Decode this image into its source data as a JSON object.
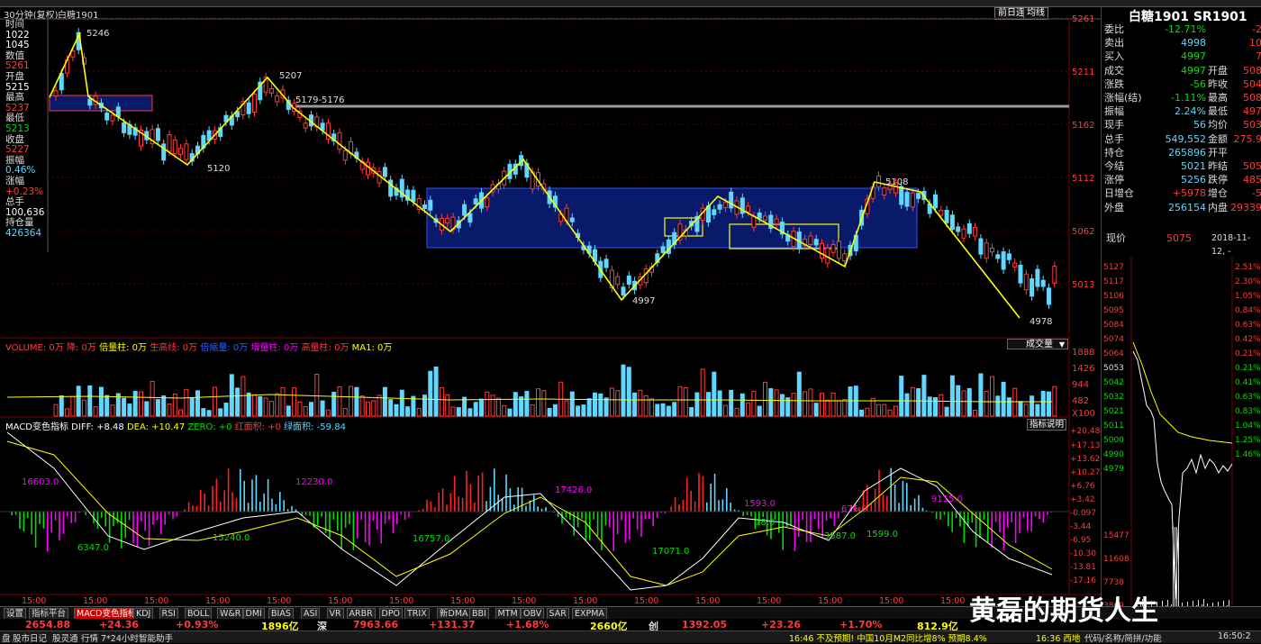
{
  "header": {
    "period_label": "30分钟(复权)",
    "symbol_label": "白糖1901",
    "btn_period": "前日连",
    "btn_avg": "均线"
  },
  "info_panel": [
    {
      "label": "时间",
      "value": "1022",
      "value2": "1045"
    },
    {
      "label": "数值",
      "value": "5261"
    },
    {
      "label": "开盘",
      "value": "5215"
    },
    {
      "label": "最高",
      "value": "5237"
    },
    {
      "label": "最低",
      "value": "5213"
    },
    {
      "label": "收盘",
      "value": "5227"
    },
    {
      "label": "振幅",
      "value": "0.46%"
    },
    {
      "label": "涨幅",
      "value": "+0.23%"
    },
    {
      "label": "总手",
      "value": "100,636"
    },
    {
      "label": "持仓量",
      "value": "426364"
    }
  ],
  "price_axis": [
    "5261",
    "5211",
    "5162",
    "5112",
    "5062",
    "5013"
  ],
  "annotations": {
    "a1": "5246",
    "a2": "5120",
    "a3": "5207",
    "a4": "5179-5176",
    "a5": "4997",
    "a6": "5108",
    "a7": "4978"
  },
  "volume_header": {
    "title": "VOLUME: 0万",
    "t2": "降: 0万",
    "t3": "倍量柱: 0万",
    "t4": "生高线: 0万",
    "t5": "倍缩量: 0万",
    "t6": "增量柱: 0万",
    "t7": "高量柱: 0万",
    "t8": "MA1: 0万",
    "dropdown": "成交量"
  },
  "volume_axis": [
    "1888",
    "1426",
    "944",
    "482",
    "X100"
  ],
  "macd_header": {
    "title": "MACD变色指标",
    "diff": "DIFF: +8.48",
    "dea": "DEA: +10.47",
    "zero": "ZERO: +0",
    "red": "红面积: +0",
    "green": "绿面积: -59.84",
    "help": "指标说明"
  },
  "macd_axis": [
    "+20.48",
    "+17.13",
    "+13.62",
    "+10.27",
    "+6.76",
    "+3.42",
    "-0.097",
    "-3.44",
    "-6.95",
    "-10.30",
    "-13.81",
    "-17.16"
  ],
  "macd_labels": {
    "m1": "16603.0",
    "m2": "6347.0",
    "m3": "12230.0",
    "m4": "15240.0",
    "m5": "16757.0",
    "m6": "17426.0",
    "m7": "17071.0",
    "m8": "1593.0",
    "m9": "78.0",
    "m10": "676.0",
    "m11": "3587.0",
    "m12": "1599.0",
    "m13": "9115.0"
  },
  "time_axis": [
    "15:00",
    "15:00",
    "15:00",
    "15:00",
    "15:00",
    "15:00",
    "15:00",
    "15:00",
    "15:00",
    "15:00",
    "15:00",
    "15:00",
    "15:00",
    "15:00",
    "15:00",
    "15:00"
  ],
  "right_panel": {
    "title": "白糖1901 SR1901",
    "rows": [
      {
        "l": "委比",
        "v": "-12.71%",
        "x": "-2"
      },
      {
        "l": "卖出",
        "v": "4998",
        "x": "10"
      },
      {
        "l": "买入",
        "v": "4997",
        "x": "7"
      },
      {
        "l": "成交",
        "v": "4997",
        "l2": "开盘",
        "x": "508"
      },
      {
        "l": "涨跌",
        "v": "-56",
        "l2": "昨收",
        "x": "504"
      },
      {
        "l": "涨幅(结)",
        "v": "-1.11%",
        "l2": "最高",
        "x": "508"
      },
      {
        "l": "振幅",
        "v": "2.24%",
        "l2": "最低",
        "x": "497"
      },
      {
        "l": "现手",
        "v": "56",
        "l2": "均价",
        "x": "503"
      },
      {
        "l": "总手",
        "v": "549,552",
        "l2": "金额",
        "x": "275.9"
      },
      {
        "l": "持仓",
        "v": "265896",
        "l2": "开平",
        "x": ""
      },
      {
        "l": "今结",
        "v": "5021",
        "l2": "昨结",
        "x": "505"
      },
      {
        "l": "涨停",
        "v": "5256",
        "l2": "跌停",
        "x": "485"
      },
      {
        "l": "日增仓",
        "v": "+5978",
        "l2": "增仓",
        "x": "-5"
      },
      {
        "l": "外盘",
        "v": "256154",
        "l2": "内盘",
        "x": "29339"
      }
    ],
    "now_label": "现价",
    "now_value": "5075",
    "now_date": "2018-11-12, -",
    "mini_axis_left": [
      "5127",
      "5117",
      "5106",
      "5095",
      "5084",
      "5074",
      "5064",
      "5053",
      "5042",
      "5032",
      "5021",
      "5011",
      "5000",
      "4990",
      "4979"
    ],
    "mini_axis_right": [
      "2.51%",
      "2.30%",
      "1.05%",
      "0.84%",
      "0.63%",
      "0.42%",
      "0.21%",
      "0.21%",
      "0.41%",
      "0.63%",
      "0.83%",
      "1.04%",
      "1.25%",
      "1.46%"
    ],
    "mini_vol_axis": [
      "15477",
      "11608",
      "7738",
      "3869"
    ]
  },
  "bottom_tabs": [
    "设置",
    "指标平台",
    "MACD变色指标",
    "KDJ",
    "RSI",
    "BOLL",
    "W&R",
    "DMI",
    "BIAS",
    "ASI",
    "VR",
    "ARBR",
    "DPO",
    "TRIX",
    "新DMA",
    "BBI",
    "MTM",
    "OBV",
    "SAR",
    "EXPMA"
  ],
  "index_row": {
    "v1": "2654.88",
    "v2": "+24.36",
    "v3": "+0.93%",
    "v4": "1896亿",
    "lbl_shen": "深",
    "v5": "7963.66",
    "v6": "+131.37",
    "v7": "+1.68%",
    "v8": "2660亿",
    "lbl_chuang": "创",
    "v9": "1392.05",
    "v10": "+23.26",
    "v11": "+1.70%",
    "v12": "812.9亿"
  },
  "status_row": {
    "s1": "盘",
    "s2": "股市日记",
    "s3": "股灵通",
    "s4": "行情",
    "s5": "7*24小时",
    "s6": "智能助手",
    "news": "16:46 不及预期! 中国10月M2同比增8% 预期8.4%",
    "s7": "16:36 西地",
    "s8": "代码/名称/简拼/功能",
    "s9": "16:50:2"
  },
  "watermark": "黄磊的期货人生",
  "colors": {
    "up": "#ff3b3b",
    "down": "#00e000",
    "cyan": "#5fd7ff",
    "yellow": "#ffff00",
    "box": "#0a1a6b",
    "magenta": "#ff00ff"
  }
}
